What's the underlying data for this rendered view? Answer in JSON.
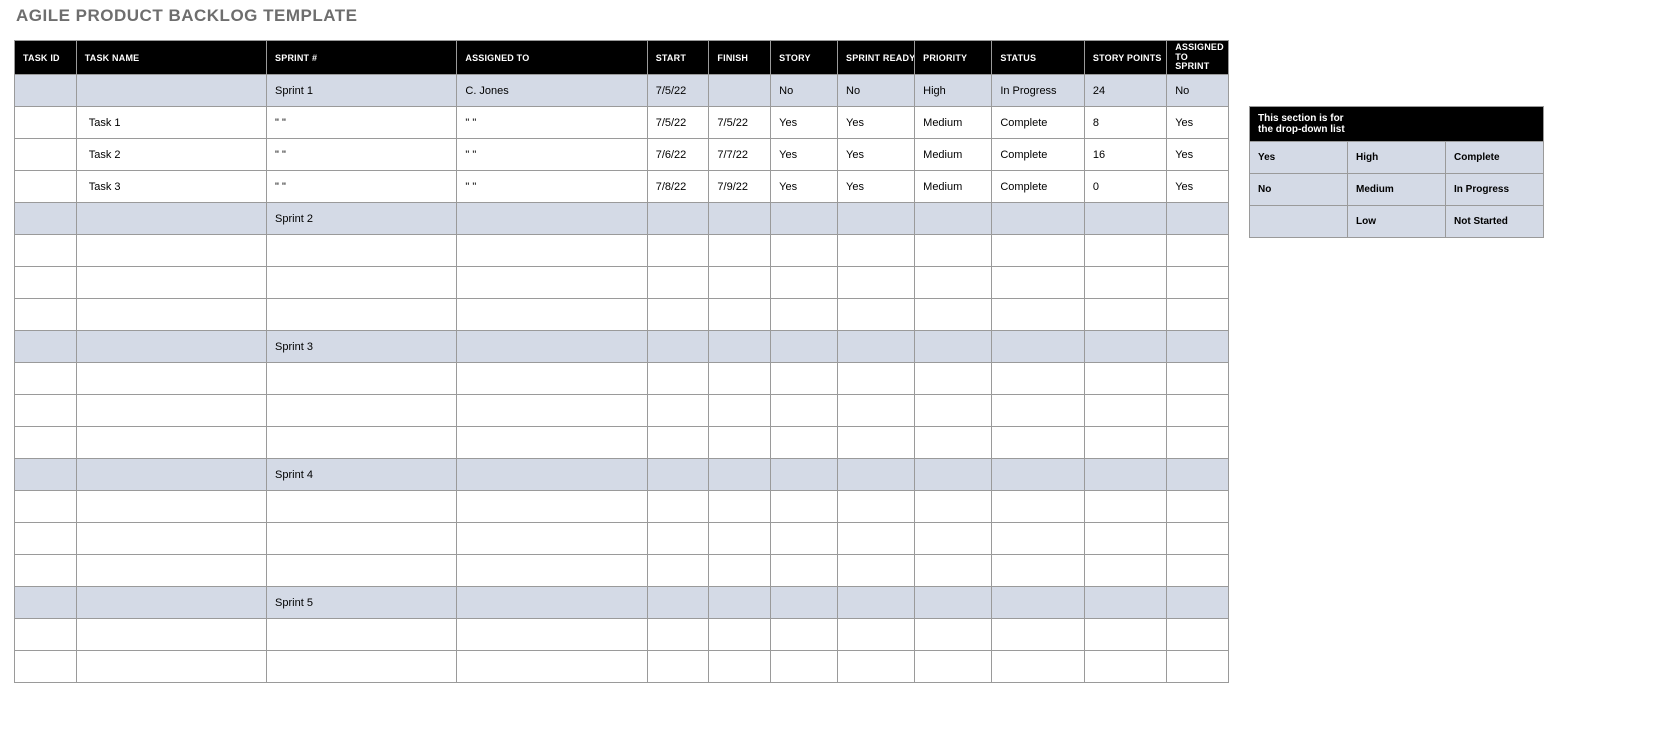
{
  "title": "AGILE PRODUCT BACKLOG TEMPLATE",
  "columns": {
    "task_id": "TASK ID",
    "task_name": "TASK NAME",
    "sprint": "SPRINT #",
    "assigned_to": "ASSIGNED TO",
    "start": "START",
    "finish": "FINISH",
    "story": "STORY",
    "sprint_ready": "SPRINT READY",
    "priority": "PRIORITY",
    "status": "STATUS",
    "story_points": "STORY POINTS",
    "assigned_to_sprint": "ASSIGNED TO SPRINT"
  },
  "rows": [
    {
      "kind": "summary",
      "task_id": "",
      "task_name": "",
      "sprint": "Sprint 1",
      "assigned_to": "C. Jones",
      "start": "7/5/22",
      "finish": "",
      "story": "No",
      "sprint_ready": "No",
      "priority": "High",
      "status": "In Progress",
      "story_points": "24",
      "assigned_to_sprint": "No"
    },
    {
      "kind": "data",
      "task_id": "",
      "task_name": "Task 1",
      "sprint": "\" \"",
      "assigned_to": "\" \"",
      "start": "7/5/22",
      "finish": "7/5/22",
      "story": "Yes",
      "sprint_ready": "Yes",
      "priority": "Medium",
      "status": "Complete",
      "story_points": "8",
      "assigned_to_sprint": "Yes"
    },
    {
      "kind": "data",
      "task_id": "",
      "task_name": "Task 2",
      "sprint": "\" \"",
      "assigned_to": "\" \"",
      "start": "7/6/22",
      "finish": "7/7/22",
      "story": "Yes",
      "sprint_ready": "Yes",
      "priority": "Medium",
      "status": "Complete",
      "story_points": "16",
      "assigned_to_sprint": "Yes"
    },
    {
      "kind": "data",
      "task_id": "",
      "task_name": "Task 3",
      "sprint": "\" \"",
      "assigned_to": "\" \"",
      "start": "7/8/22",
      "finish": "7/9/22",
      "story": "Yes",
      "sprint_ready": "Yes",
      "priority": "Medium",
      "status": "Complete",
      "story_points": "0",
      "assigned_to_sprint": "Yes"
    },
    {
      "kind": "summary",
      "task_id": "",
      "task_name": "",
      "sprint": "Sprint 2",
      "assigned_to": "",
      "start": "",
      "finish": "",
      "story": "",
      "sprint_ready": "",
      "priority": "",
      "status": "",
      "story_points": "",
      "assigned_to_sprint": ""
    },
    {
      "kind": "data"
    },
    {
      "kind": "data"
    },
    {
      "kind": "data"
    },
    {
      "kind": "summary",
      "task_id": "",
      "task_name": "",
      "sprint": "Sprint 3",
      "assigned_to": "",
      "start": "",
      "finish": "",
      "story": "",
      "sprint_ready": "",
      "priority": "",
      "status": "",
      "story_points": "",
      "assigned_to_sprint": ""
    },
    {
      "kind": "data"
    },
    {
      "kind": "data"
    },
    {
      "kind": "data"
    },
    {
      "kind": "summary",
      "task_id": "",
      "task_name": "",
      "sprint": "Sprint 4",
      "assigned_to": "",
      "start": "",
      "finish": "",
      "story": "",
      "sprint_ready": "",
      "priority": "",
      "status": "",
      "story_points": "",
      "assigned_to_sprint": ""
    },
    {
      "kind": "data"
    },
    {
      "kind": "data"
    },
    {
      "kind": "data"
    },
    {
      "kind": "summary",
      "task_id": "",
      "task_name": "",
      "sprint": "Sprint 5",
      "assigned_to": "",
      "start": "",
      "finish": "",
      "story": "",
      "sprint_ready": "",
      "priority": "",
      "status": "",
      "story_points": "",
      "assigned_to_sprint": ""
    },
    {
      "kind": "data"
    },
    {
      "kind": "data"
    }
  ],
  "dropdown": {
    "header": "This section is for\nthe drop-down list",
    "yes_no": [
      "Yes",
      "No",
      ""
    ],
    "priority": [
      "High",
      "Medium",
      "Low"
    ],
    "status": [
      "Complete",
      "In Progress",
      "Not Started"
    ]
  }
}
